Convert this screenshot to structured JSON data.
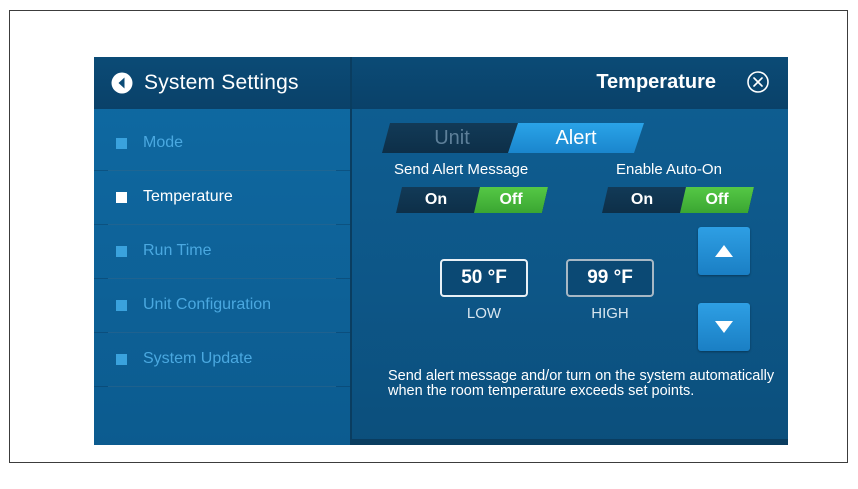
{
  "sidebar": {
    "title": "System Settings",
    "back_icon": "back-arrow-circle-icon",
    "items": [
      {
        "label": "Mode",
        "active": false
      },
      {
        "label": "Temperature",
        "active": true
      },
      {
        "label": "Run Time",
        "active": false
      },
      {
        "label": "Unit Configuration",
        "active": false
      },
      {
        "label": "System Update",
        "active": false
      }
    ]
  },
  "header": {
    "title": "Temperature",
    "close_icon": "close-circle-icon"
  },
  "tabs": [
    {
      "label": "Unit",
      "selected": false
    },
    {
      "label": "Alert",
      "selected": true
    }
  ],
  "send_alert": {
    "label": "Send Alert Message",
    "on_label": "On",
    "off_label": "Off",
    "value": "Off"
  },
  "auto_on": {
    "label": "Enable Auto-On",
    "on_label": "On",
    "off_label": "Off",
    "value": "Off"
  },
  "low": {
    "value": "50 °F",
    "label": "LOW"
  },
  "high": {
    "value": "99 °F",
    "label": "HIGH"
  },
  "description": "Send alert message and/or turn on the system automatically when the room temperature exceeds set points.",
  "colors": {
    "accent_blue": "#1a86cd",
    "toggle_green": "#3aa632",
    "background": "#0d5687"
  }
}
